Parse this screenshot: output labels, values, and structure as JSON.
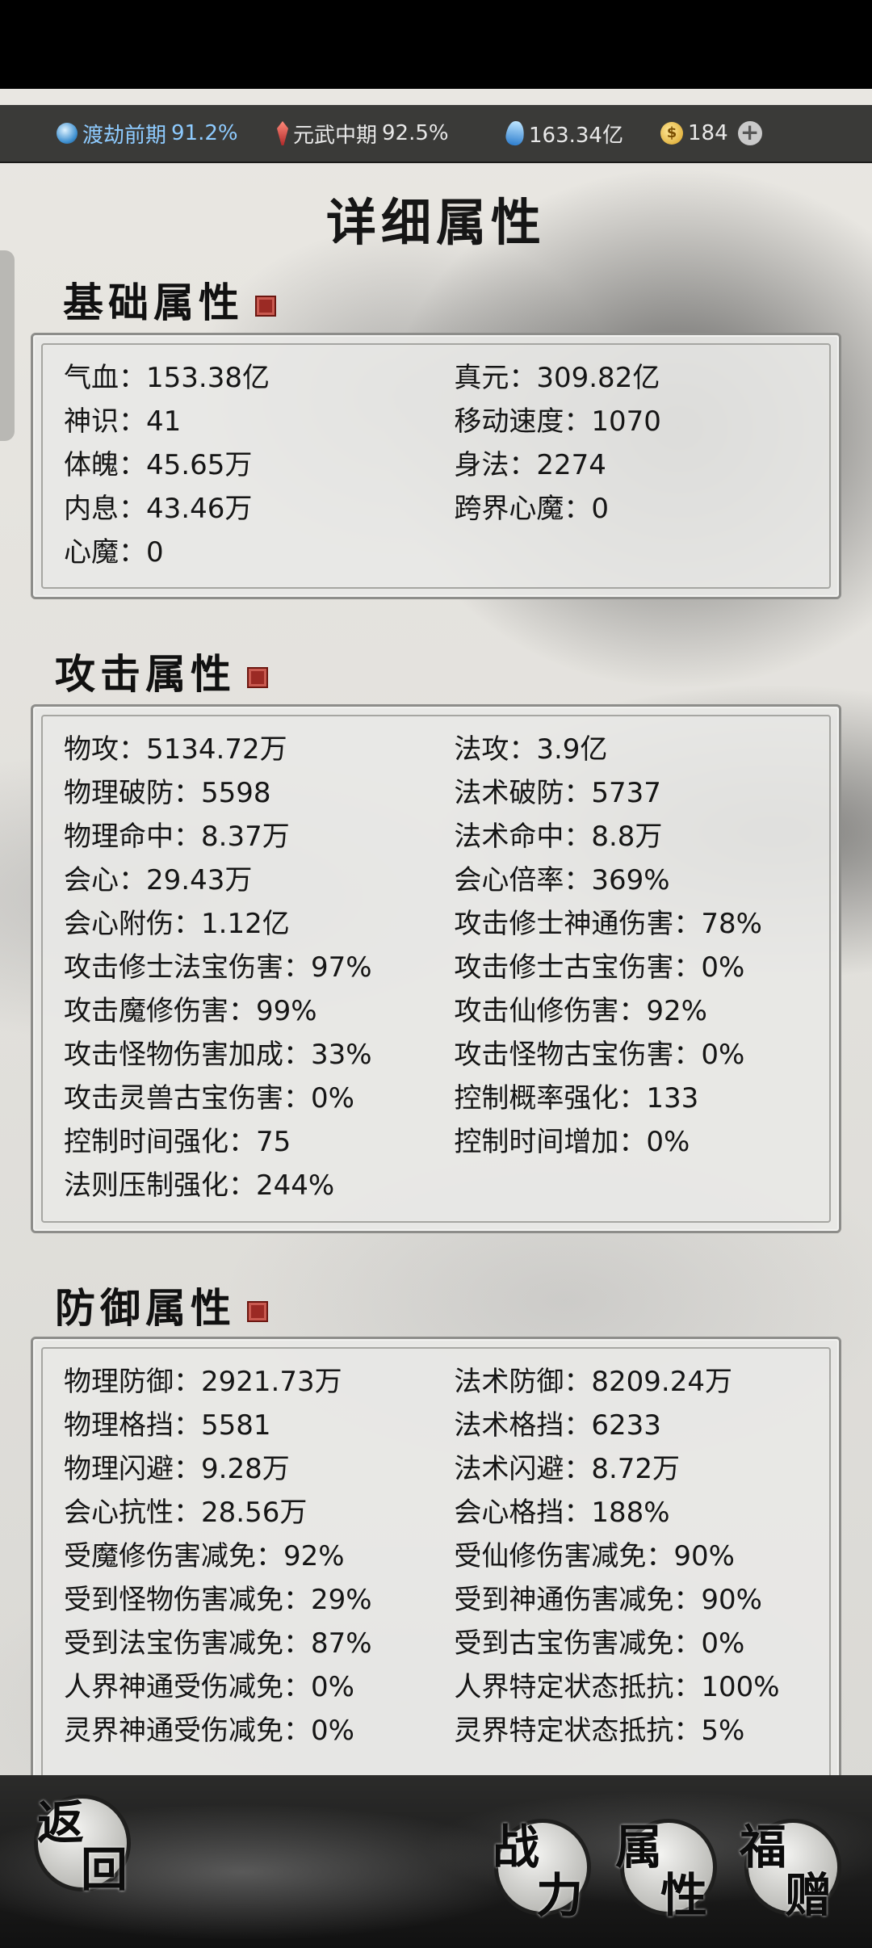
{
  "status_bar": {
    "realm1_name": "渡劫前期",
    "realm1_pct": "91.2%",
    "realm2_name": "元武中期",
    "realm2_pct": "92.5%",
    "spirit_stones": "163.34亿",
    "gold": "184"
  },
  "title": "详细属性",
  "sections": {
    "basic": {
      "title": "基础属性",
      "rows": [
        [
          "气血：153.38亿",
          "真元：309.82亿"
        ],
        [
          "神识：41",
          "移动速度：1070"
        ],
        [
          "体魄：45.65万",
          "身法：2274"
        ],
        [
          "内息：43.46万",
          "跨界心魔：0"
        ],
        [
          "心魔：0",
          ""
        ]
      ]
    },
    "attack": {
      "title": "攻击属性",
      "rows": [
        [
          "物攻：5134.72万",
          "法攻：3.9亿"
        ],
        [
          "物理破防：5598",
          "法术破防：5737"
        ],
        [
          "物理命中：8.37万",
          "法术命中：8.8万"
        ],
        [
          "会心：29.43万",
          "会心倍率：369%"
        ],
        [
          "会心附伤：1.12亿",
          "攻击修士神通伤害：78%"
        ],
        [
          "攻击修士法宝伤害：97%",
          "攻击修士古宝伤害：0%"
        ],
        [
          "攻击魔修伤害：99%",
          "攻击仙修伤害：92%"
        ],
        [
          "攻击怪物伤害加成：33%",
          "攻击怪物古宝伤害：0%"
        ],
        [
          "攻击灵兽古宝伤害：0%",
          "控制概率强化：133"
        ],
        [
          "控制时间强化：75",
          "控制时间增加：0%"
        ],
        [
          "法则压制强化：244%",
          ""
        ]
      ]
    },
    "defense": {
      "title": "防御属性",
      "rows": [
        [
          "物理防御：2921.73万",
          "法术防御：8209.24万"
        ],
        [
          "物理格挡：5581",
          "法术格挡：6233"
        ],
        [
          "物理闪避：9.28万",
          "法术闪避：8.72万"
        ],
        [
          "会心抗性：28.56万",
          "会心格挡：188%"
        ],
        [
          "受魔修伤害减免：92%",
          "受仙修伤害减免：90%"
        ],
        [
          "受到怪物伤害减免：29%",
          "受到神通伤害减免：90%"
        ],
        [
          "受到法宝伤害减免：87%",
          "受到古宝伤害减免：0%"
        ],
        [
          "人界神通受伤减免：0%",
          "人界特定状态抵抗：100%"
        ],
        [
          "灵界神通受伤减免：0%",
          "灵界特定状态抵抗：5%"
        ]
      ]
    }
  },
  "bottom_nav": {
    "back": [
      "返",
      "回"
    ],
    "combat_power": [
      "战",
      "力"
    ],
    "attributes": [
      "属",
      "性"
    ],
    "blessing": [
      "福",
      "赠"
    ]
  },
  "icons": {
    "realm1": "orb-icon",
    "realm2": "sword-icon",
    "spirit_stones": "droplet-icon",
    "gold": "coin-icon",
    "add": "plus-icon"
  },
  "colors": {
    "status_bar_bg": "#3a3a38",
    "panel_bg": "#e8e8e6",
    "seal_red": "#9b2a24",
    "realm1_text": "#8ecbff"
  }
}
